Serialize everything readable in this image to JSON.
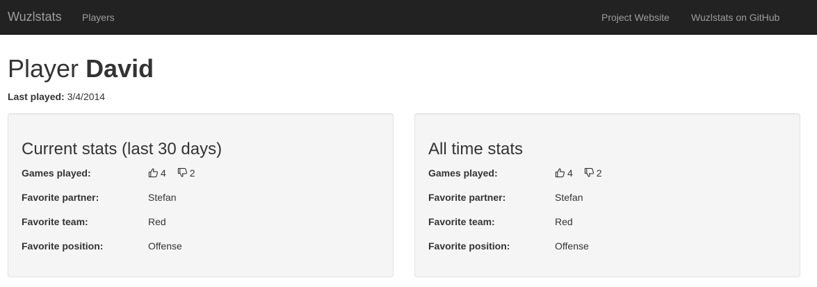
{
  "nav": {
    "brand": "Wuzlstats",
    "players": "Players",
    "project_website": "Project Website",
    "github": "Wuzlstats on GitHub"
  },
  "page": {
    "title_prefix": "Player",
    "player_name": "David",
    "last_played_label": "Last played:",
    "last_played_value": "3/4/2014"
  },
  "current": {
    "title": "Current stats (last 30 days)",
    "games_played_label": "Games played:",
    "wins": "4",
    "losses": "2",
    "partner_label": "Favorite partner:",
    "partner": "Stefan",
    "team_label": "Favorite team:",
    "team": "Red",
    "position_label": "Favorite position:",
    "position": "Offense"
  },
  "alltime": {
    "title": "All time stats",
    "games_played_label": "Games played:",
    "wins": "4",
    "losses": "2",
    "partner_label": "Favorite partner:",
    "partner": "Stefan",
    "team_label": "Favorite team:",
    "team": "Red",
    "position_label": "Favorite position:",
    "position": "Offense"
  },
  "icons": {
    "win": "thumbs-up-icon",
    "loss": "thumbs-down-icon"
  },
  "colors": {
    "navbar_bg": "#222222",
    "nav_text": "#9d9d9d",
    "well_bg": "#f5f5f5",
    "text": "#333333"
  }
}
